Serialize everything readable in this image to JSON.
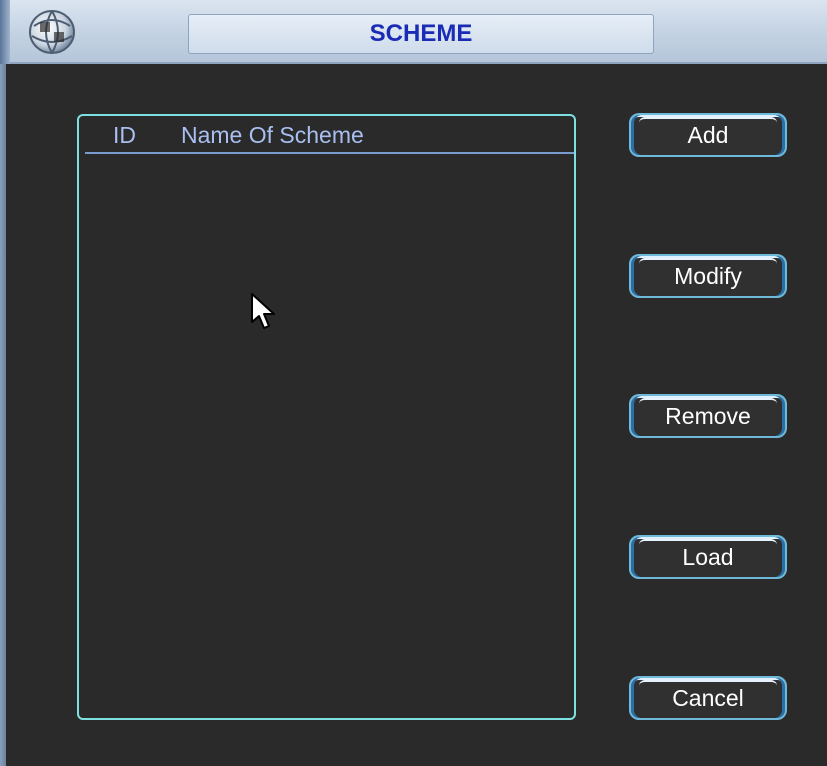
{
  "window": {
    "title": "SCHEME",
    "icon": "globe-icon"
  },
  "list": {
    "columns": [
      {
        "key": "id",
        "label": "ID"
      },
      {
        "key": "name",
        "label": "Name Of Scheme"
      }
    ],
    "rows": []
  },
  "buttons": {
    "add": "Add",
    "modify": "Modify",
    "remove": "Remove",
    "load": "Load",
    "cancel": "Cancel"
  },
  "colors": {
    "title_text": "#1a2bb5",
    "panel_border": "#7ee0e0",
    "header_text": "#a9bff0",
    "background": "#2a2a2a"
  },
  "cursor": "arrow-cursor-icon"
}
